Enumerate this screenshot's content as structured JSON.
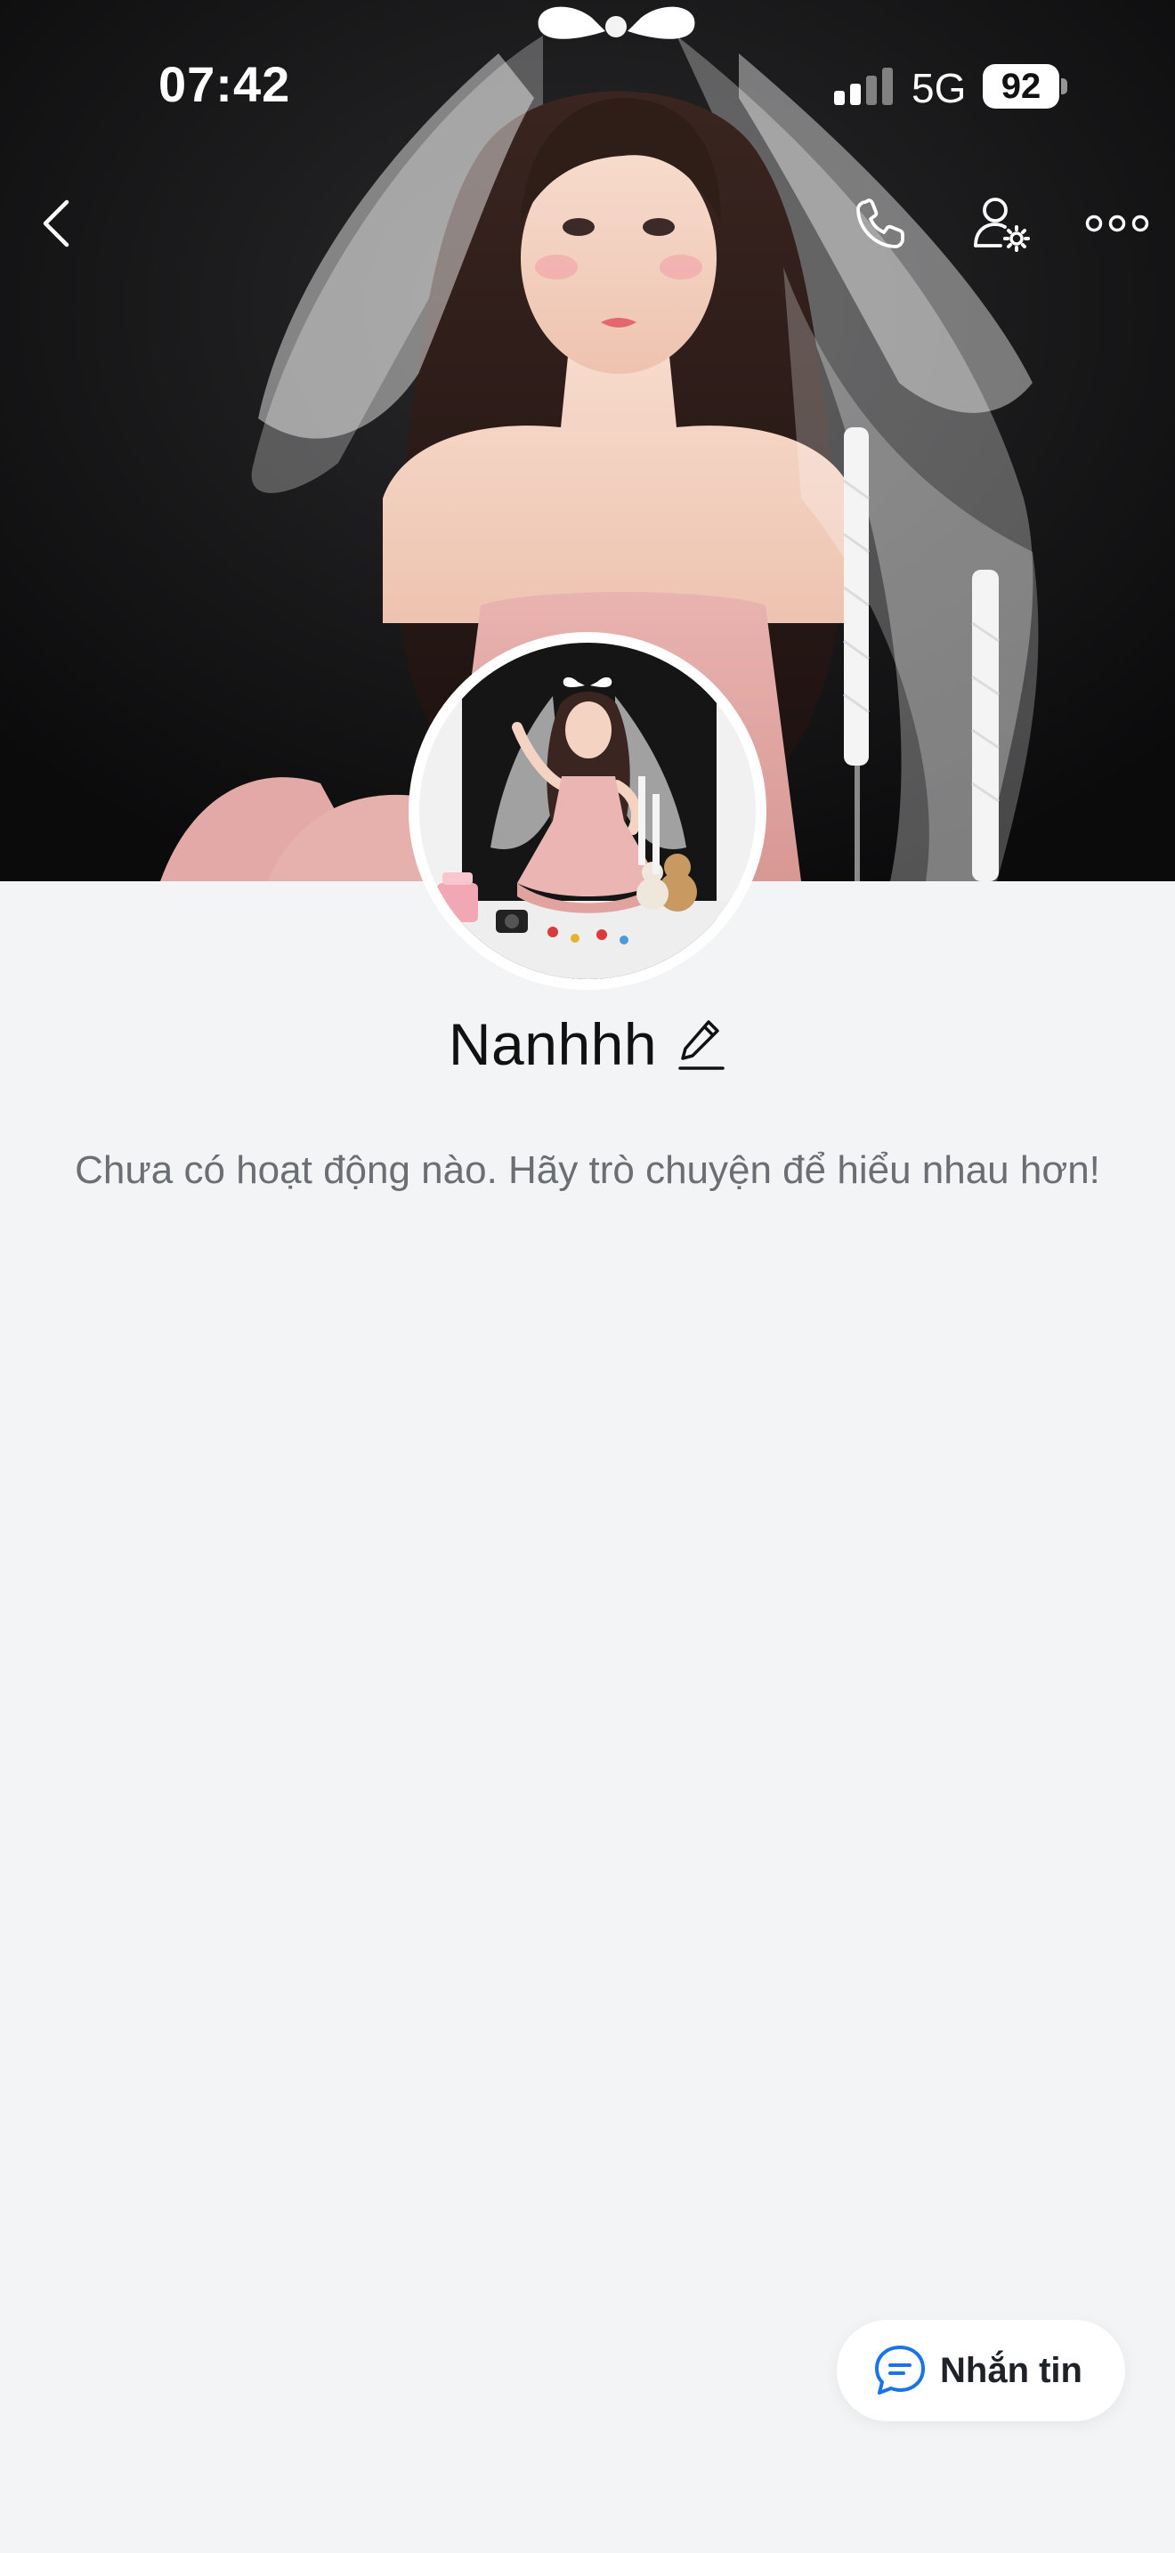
{
  "status_bar": {
    "time": "07:42",
    "network": "5G",
    "battery": "92"
  },
  "nav": {
    "back_icon": "chevron-left-icon",
    "call_icon": "phone-icon",
    "settings_icon": "user-settings-icon",
    "more_icon": "more-horizontal-icon"
  },
  "profile": {
    "name": "Nanhhh",
    "edit_icon": "pencil-icon",
    "empty_message": "Chưa có hoạt động nào. Hãy trò chuyện để hiểu nhau hơn!"
  },
  "message_button": {
    "label": "Nhắn tin",
    "icon": "chat-bubble-icon",
    "accent": "#1a73e8"
  },
  "colors": {
    "background": "#f3f4f6",
    "cover_background": "#0f0f10"
  }
}
